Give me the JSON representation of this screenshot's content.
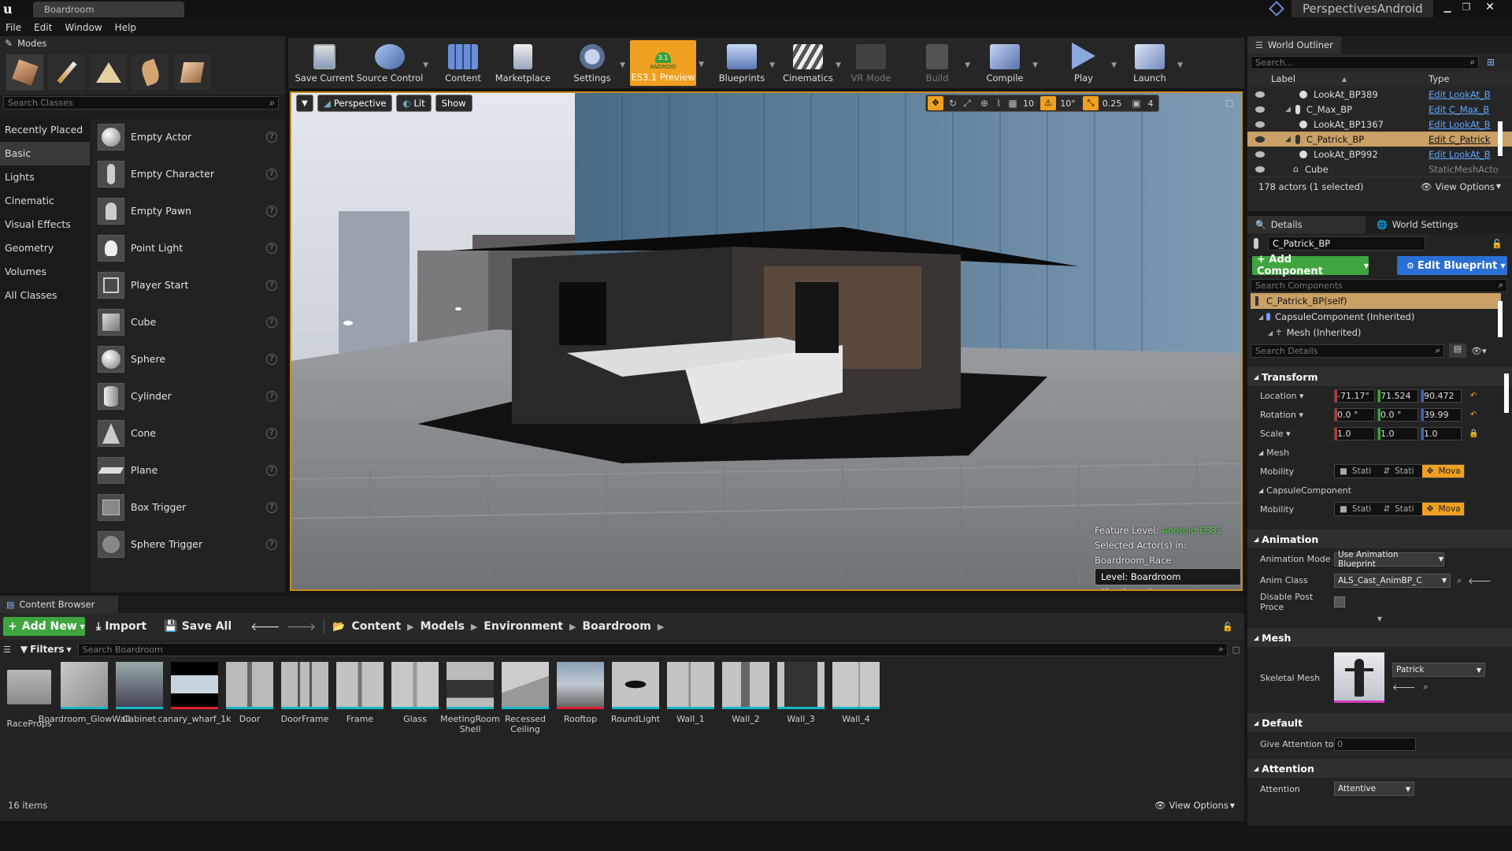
{
  "window": {
    "tab_title": "Boardroom",
    "project": "PerspectivesAndroid"
  },
  "menu": [
    "File",
    "Edit",
    "Window",
    "Help"
  ],
  "modes": {
    "title": "Modes",
    "search_placeholder": "Search Classes",
    "categories": [
      "Recently Placed",
      "Basic",
      "Lights",
      "Cinematic",
      "Visual Effects",
      "Geometry",
      "Volumes",
      "All Classes"
    ],
    "selected_category": "Basic",
    "items": [
      "Empty Actor",
      "Empty Character",
      "Empty Pawn",
      "Point Light",
      "Player Start",
      "Cube",
      "Sphere",
      "Cylinder",
      "Cone",
      "Plane",
      "Box Trigger",
      "Sphere Trigger"
    ]
  },
  "toolbar": {
    "items": [
      {
        "label": "Save Current",
        "icon": "save-icon"
      },
      {
        "label": "Source Control",
        "icon": "source-control-icon"
      },
      {
        "label": "Content",
        "icon": "content-icon"
      },
      {
        "label": "Marketplace",
        "icon": "marketplace-icon"
      },
      {
        "label": "Settings",
        "icon": "settings-icon"
      },
      {
        "label": "ES3.1 Preview",
        "icon": "android-icon",
        "badge": "3.1",
        "badge2": "ANDROID"
      },
      {
        "label": "Blueprints",
        "icon": "blueprints-icon"
      },
      {
        "label": "Cinematics",
        "icon": "cinematics-icon"
      },
      {
        "label": "VR Mode",
        "icon": "vr-icon"
      },
      {
        "label": "Build",
        "icon": "build-icon"
      },
      {
        "label": "Compile",
        "icon": "compile-icon"
      },
      {
        "label": "Play",
        "icon": "play-icon"
      },
      {
        "label": "Launch",
        "icon": "launch-icon"
      }
    ]
  },
  "viewport": {
    "perspective": "Perspective",
    "lit": "Lit",
    "show": "Show",
    "grid_snap": "10",
    "rot_snap": "10°",
    "scale_snap": "0.25",
    "cam_speed": "4",
    "feature_level_label": "Feature Level:",
    "feature_level_value": "Android ES31",
    "selected_actors": "Selected Actor(s) in:",
    "selected_level": "Boardroom_Race",
    "level": "Level:  Boardroom (Persistent)"
  },
  "outliner": {
    "title": "World Outliner",
    "search_placeholder": "Search...",
    "col_label": "Label",
    "col_type": "Type",
    "rows": [
      {
        "label": "LookAt_BP389",
        "type": "Edit LookAt_B",
        "link": true
      },
      {
        "label": "C_Max_BP",
        "type": "Edit C_Max_B",
        "link": true
      },
      {
        "label": "LookAt_BP1367",
        "type": "Edit LookAt_B",
        "link": true
      },
      {
        "label": "C_Patrick_BP",
        "type": "Edit C_Patrick",
        "link": true,
        "selected": true
      },
      {
        "label": "LookAt_BP992",
        "type": "Edit LookAt_B",
        "link": true
      },
      {
        "label": "Cube",
        "type": "StaticMeshActo",
        "link": false
      }
    ],
    "status": "178 actors (1 selected)",
    "view_options": "View Options"
  },
  "details": {
    "tab_details": "Details",
    "tab_world": "World Settings",
    "actor_name": "C_Patrick_BP",
    "add_component": "+ Add Component",
    "edit_blueprint": "Edit Blueprint",
    "search_components": "Search Components",
    "components": [
      "C_Patrick_BP(self)",
      "CapsuleComponent (Inherited)",
      "Mesh (Inherited)"
    ],
    "search_details": "Search Details",
    "transform": {
      "title": "Transform",
      "location_label": "Location",
      "location": [
        "-71.17°",
        "71.524",
        "90.472"
      ],
      "rotation_label": "Rotation",
      "rotation": [
        "0.0 °",
        "0.0 °",
        "39.99"
      ],
      "scale_label": "Scale",
      "scale": [
        "1.0",
        "1.0",
        "1.0"
      ],
      "mesh_group": "Mesh",
      "mobility_label": "Mobility",
      "mobility": [
        "Stati",
        "Stati",
        "Mova"
      ],
      "capsule_group": "CapsuleComponent"
    },
    "animation": {
      "title": "Animation",
      "mode_label": "Animation Mode",
      "mode_value": "Use Animation Blueprint",
      "class_label": "Anim Class",
      "class_value": "ALS_Cast_AnimBP_C",
      "disable_label": "Disable Post Proce"
    },
    "mesh": {
      "title": "Mesh",
      "skeletal_label": "Skeletal Mesh",
      "skeletal_value": "Patrick"
    },
    "default": {
      "title": "Default",
      "give_label": "Give Attention to D",
      "give_value": "0"
    },
    "attention": {
      "title": "Attention",
      "label": "Attention",
      "value": "Attentive"
    }
  },
  "content_browser": {
    "title": "Content Browser",
    "add_new": "Add New",
    "import": "Import",
    "save_all": "Save All",
    "path": [
      "Content",
      "Models",
      "Environment",
      "Boardroom"
    ],
    "filters": "Filters",
    "search_placeholder": "Search Boardroom",
    "items": [
      {
        "name": "RaceProps",
        "kind": "folder"
      },
      {
        "name": "Boardroom_GlowWall"
      },
      {
        "name": "Cabinet"
      },
      {
        "name": "canary_wharf_1k"
      },
      {
        "name": "Door"
      },
      {
        "name": "DoorFrame"
      },
      {
        "name": "Frame"
      },
      {
        "name": "Glass"
      },
      {
        "name": "MeetingRoom Shell"
      },
      {
        "name": "Recessed Ceiling"
      },
      {
        "name": "Rooftop"
      },
      {
        "name": "RoundLight"
      },
      {
        "name": "Wall_1"
      },
      {
        "name": "Wall_2"
      },
      {
        "name": "Wall_3"
      },
      {
        "name": "Wall_4"
      }
    ],
    "count": "16 items",
    "view_options": "View Options"
  },
  "colors": {
    "accent_orange": "#f0a020",
    "selection": "#c9a066",
    "link": "#5fa6ff",
    "green": "#3fa53f",
    "blue": "#2a6fd3",
    "cyan": "#16b6c7"
  }
}
